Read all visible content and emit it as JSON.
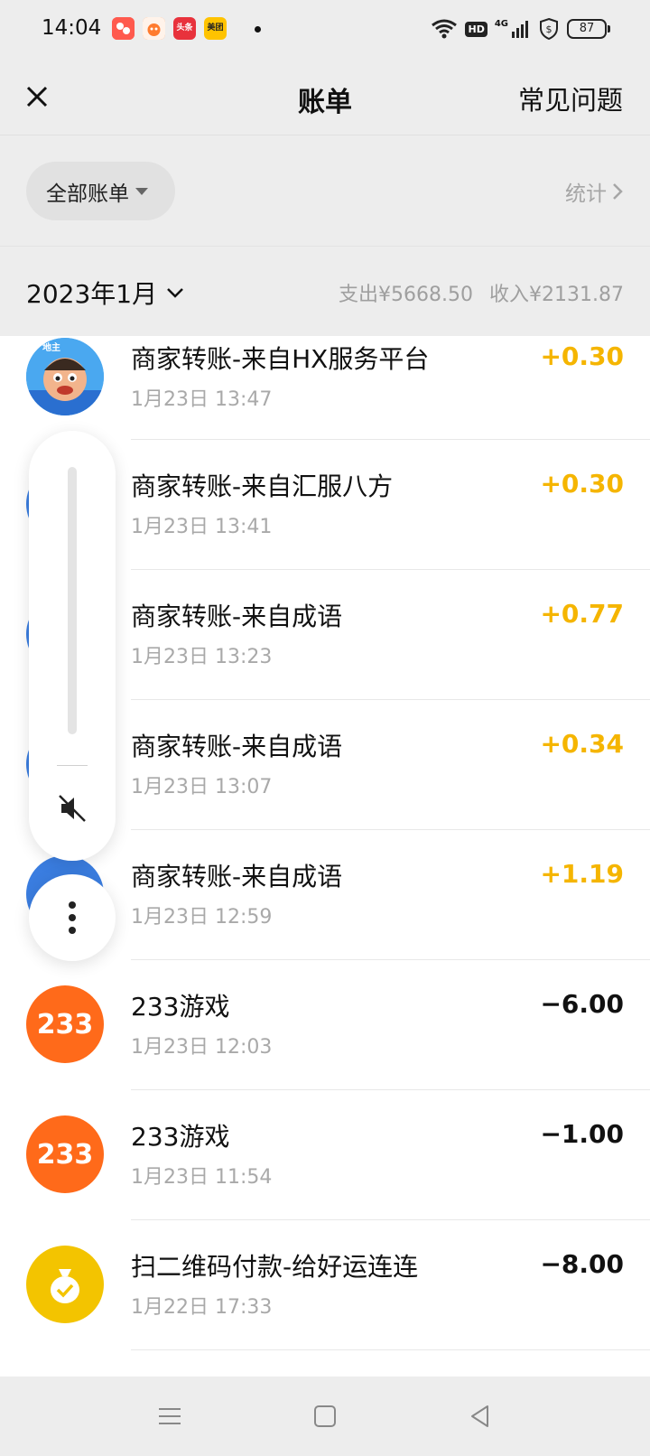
{
  "status_bar": {
    "time": "14:04",
    "apps": [
      {
        "icon": "camera-app-icon",
        "color": "#ff5a4e"
      },
      {
        "icon": "pet-app-icon",
        "color": "#ff7b2e"
      },
      {
        "icon": "toutiao-app-icon",
        "label": "头条",
        "color": "#e8323c"
      },
      {
        "icon": "meituan-app-icon",
        "label": "美团",
        "color": "#ffc300"
      }
    ],
    "hd": "HD",
    "network": "4G",
    "battery": "87"
  },
  "nav": {
    "title": "账单",
    "faq": "常见问题"
  },
  "filter": {
    "label": "全部账单",
    "stats": "统计"
  },
  "month": {
    "label": "2023年1月",
    "expense": "支出¥5668.50",
    "income": "收入¥2131.87"
  },
  "transactions": [
    {
      "title": "商家转账-来自HX服务平台",
      "time": "1月23日 13:47",
      "amount": "+0.30",
      "type": "in"
    },
    {
      "title": "商家转账-来自汇服八方",
      "time": "1月23日 13:41",
      "amount": "+0.30",
      "type": "in"
    },
    {
      "title": "商家转账-来自成语",
      "time": "1月23日 13:23",
      "amount": "+0.77",
      "type": "in"
    },
    {
      "title": "商家转账-来自成语",
      "time": "1月23日 13:07",
      "amount": "+0.34",
      "type": "in"
    },
    {
      "title": "商家转账-来自成语",
      "time": "1月23日 12:59",
      "amount": "+1.19",
      "type": "in"
    },
    {
      "title": "233游戏",
      "time": "1月23日 12:03",
      "amount": "−6.00",
      "type": "out",
      "avatar_text": "233"
    },
    {
      "title": "233游戏",
      "time": "1月23日 11:54",
      "amount": "−1.00",
      "type": "out",
      "avatar_text": "233"
    },
    {
      "title": "扫二维码付款-给好运连连",
      "time": "1月22日 17:33",
      "amount": "−8.00",
      "type": "out"
    }
  ],
  "colors": {
    "income": "#f5b500",
    "expense": "#111111",
    "background": "#ededed"
  }
}
